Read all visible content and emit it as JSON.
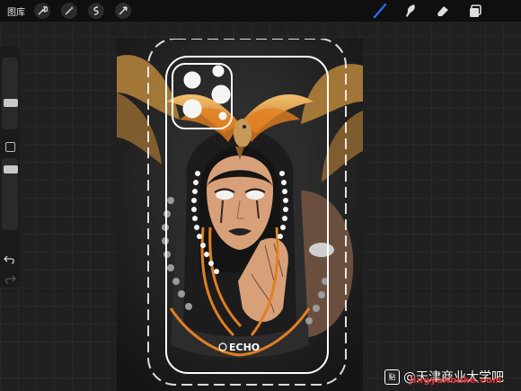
{
  "topbar": {
    "gallery_label": "图库",
    "left_tools": [
      "wrench-icon",
      "magic-wand-icon",
      "selection-icon",
      "transform-arrow-icon"
    ],
    "right_tools": [
      "brush-icon",
      "smudge-icon",
      "eraser-icon",
      "layers-icon"
    ],
    "active_tool": "brush-icon",
    "accent_color": "#2f6bff"
  },
  "sidebar": {
    "controls": [
      "brush-size-slider",
      "modify-button",
      "opacity-slider",
      "undo-icon",
      "redo-icon"
    ]
  },
  "artwork": {
    "brand_label": "ECHO",
    "palette": {
      "gold": "#d99a3a",
      "orange": "#e27f22",
      "dark": "#2a2a2a",
      "skin": "#d8a079",
      "pearl": "#f4f4f4"
    }
  },
  "watermark": {
    "text": "@天津商业大学吧",
    "url": "jingyanbake.com"
  }
}
